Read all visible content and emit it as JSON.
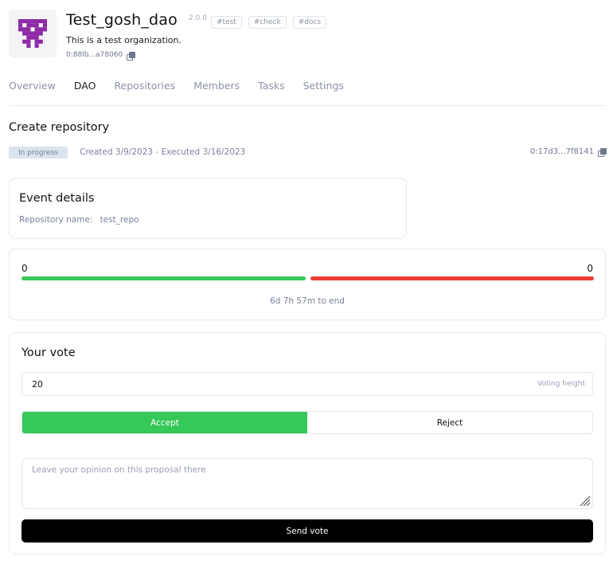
{
  "org": {
    "name": "Test_gosh_dao",
    "version": "2.0.0",
    "tags": [
      "#test",
      "#check",
      "#docs"
    ],
    "description": "This is a test organization.",
    "address": "0:88lb...a78060",
    "logo_color": "#8e2aa6"
  },
  "tabs": [
    {
      "label": "Overview",
      "active": false
    },
    {
      "label": "DAO",
      "active": true
    },
    {
      "label": "Repositories",
      "active": false
    },
    {
      "label": "Members",
      "active": false
    },
    {
      "label": "Tasks",
      "active": false
    },
    {
      "label": "Settings",
      "active": false
    }
  ],
  "proposal": {
    "title": "Create repository",
    "status": "In progress",
    "dates": "Created 3/9/2023 - Executed 3/16/2023",
    "address": "0:17d3...7f8141"
  },
  "event": {
    "title": "Event details",
    "field_label": "Repository name:",
    "field_value": "test_repo"
  },
  "results": {
    "accept_count": "0",
    "reject_count": "0",
    "accept_color": "#37c85a",
    "reject_color": "#ea3e37",
    "time_remaining": "6d 7h 57m to end"
  },
  "vote": {
    "title": "Your vote",
    "amount": "20",
    "amount_label": "Voting height",
    "accept_label": "Accept",
    "reject_label": "Reject",
    "comment_placeholder": "Leave your opinion on this proposal there",
    "send_label": "Send vote"
  },
  "icons": {
    "copy": "copy-icon",
    "resize": "resize-handle-icon",
    "logo": "pixel-logo-icon"
  }
}
